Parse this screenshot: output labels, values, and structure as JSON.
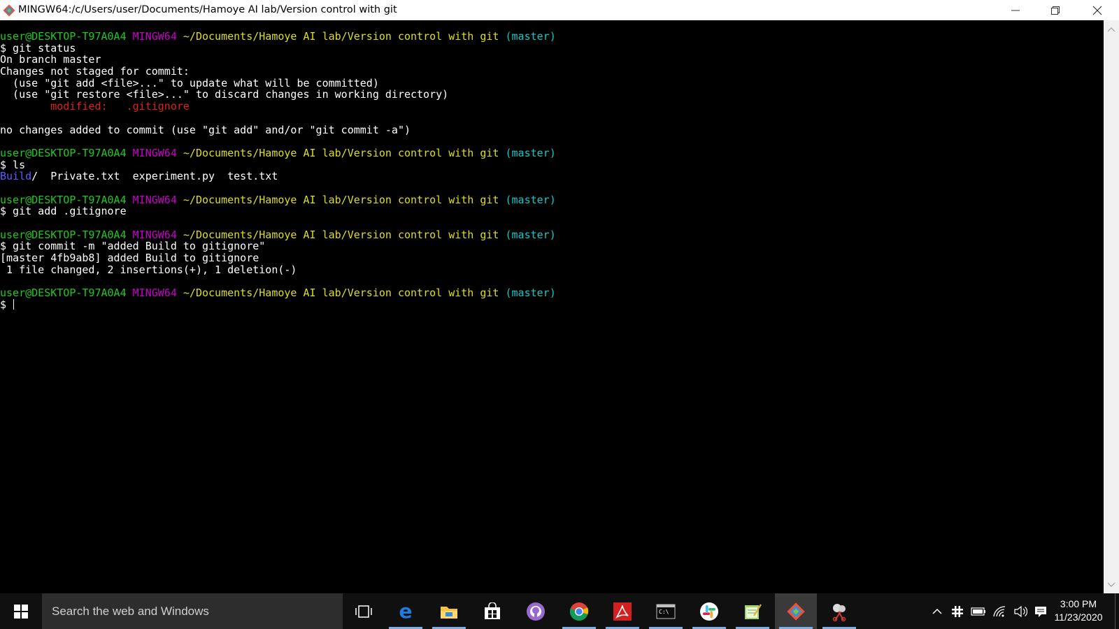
{
  "window": {
    "title": "MINGW64:/c/Users/user/Documents/Hamoye AI lab/Version control with git"
  },
  "terminal": {
    "lines": [
      [
        {
          "t": "user@DESKTOP-T97A0A4",
          "c": "g"
        },
        {
          "t": " ",
          "c": ""
        },
        {
          "t": "MINGW64",
          "c": "m"
        },
        {
          "t": " ",
          "c": ""
        },
        {
          "t": "~/Documents/Hamoye AI lab/Version control with git",
          "c": "y"
        },
        {
          "t": " ",
          "c": ""
        },
        {
          "t": "(master)",
          "c": "c"
        }
      ],
      [
        {
          "t": "$ git status",
          "c": ""
        }
      ],
      [
        {
          "t": "On branch master",
          "c": ""
        }
      ],
      [
        {
          "t": "Changes not staged for commit:",
          "c": ""
        }
      ],
      [
        {
          "t": "  (use \"git add <file>...\" to update what will be committed)",
          "c": ""
        }
      ],
      [
        {
          "t": "  (use \"git restore <file>...\" to discard changes in working directory)",
          "c": ""
        }
      ],
      [
        {
          "t": "        ",
          "c": ""
        },
        {
          "t": "modified:   .gitignore",
          "c": "r"
        }
      ],
      [],
      [
        {
          "t": "no changes added to commit (use \"git add\" and/or \"git commit -a\")",
          "c": ""
        }
      ],
      [],
      [
        {
          "t": "user@DESKTOP-T97A0A4",
          "c": "g"
        },
        {
          "t": " ",
          "c": ""
        },
        {
          "t": "MINGW64",
          "c": "m"
        },
        {
          "t": " ",
          "c": ""
        },
        {
          "t": "~/Documents/Hamoye AI lab/Version control with git",
          "c": "y"
        },
        {
          "t": " ",
          "c": ""
        },
        {
          "t": "(master)",
          "c": "c"
        }
      ],
      [
        {
          "t": "$ ls",
          "c": ""
        }
      ],
      [
        {
          "t": "Build",
          "c": "b"
        },
        {
          "t": "/  Private.txt  experiment.py  test.txt",
          "c": ""
        }
      ],
      [],
      [
        {
          "t": "user@DESKTOP-T97A0A4",
          "c": "g"
        },
        {
          "t": " ",
          "c": ""
        },
        {
          "t": "MINGW64",
          "c": "m"
        },
        {
          "t": " ",
          "c": ""
        },
        {
          "t": "~/Documents/Hamoye AI lab/Version control with git",
          "c": "y"
        },
        {
          "t": " ",
          "c": ""
        },
        {
          "t": "(master)",
          "c": "c"
        }
      ],
      [
        {
          "t": "$ git add .gitignore",
          "c": ""
        }
      ],
      [],
      [
        {
          "t": "user@DESKTOP-T97A0A4",
          "c": "g"
        },
        {
          "t": " ",
          "c": ""
        },
        {
          "t": "MINGW64",
          "c": "m"
        },
        {
          "t": " ",
          "c": ""
        },
        {
          "t": "~/Documents/Hamoye AI lab/Version control with git",
          "c": "y"
        },
        {
          "t": " ",
          "c": ""
        },
        {
          "t": "(master)",
          "c": "c"
        }
      ],
      [
        {
          "t": "$ git commit -m \"added Build to gitignore\"",
          "c": ""
        }
      ],
      [
        {
          "t": "[master 4fb9ab8] added Build to gitignore",
          "c": ""
        }
      ],
      [
        {
          "t": " 1 file changed, 2 insertions(+), 1 deletion(-)",
          "c": ""
        }
      ],
      [],
      [
        {
          "t": "user@DESKTOP-T97A0A4",
          "c": "g"
        },
        {
          "t": " ",
          "c": ""
        },
        {
          "t": "MINGW64",
          "c": "m"
        },
        {
          "t": " ",
          "c": ""
        },
        {
          "t": "~/Documents/Hamoye AI lab/Version control with git",
          "c": "y"
        },
        {
          "t": " ",
          "c": ""
        },
        {
          "t": "(master)",
          "c": "c"
        }
      ],
      [
        {
          "t": "$ ",
          "c": ""
        },
        {
          "cursor": true
        }
      ]
    ]
  },
  "taskbar": {
    "search_placeholder": "Search the web and Windows",
    "clock_time": "3:00 PM",
    "clock_date": "11/23/2020",
    "items": [
      {
        "name": "task-view-icon"
      },
      {
        "name": "edge-icon"
      },
      {
        "name": "file-explorer-icon"
      },
      {
        "name": "store-icon"
      },
      {
        "name": "github-desktop-icon"
      },
      {
        "name": "chrome-icon"
      },
      {
        "name": "acrobat-icon"
      },
      {
        "name": "cmd-icon"
      },
      {
        "name": "slack-icon"
      },
      {
        "name": "notepad-icon"
      },
      {
        "name": "git-bash-icon"
      },
      {
        "name": "snipping-tool-icon"
      }
    ]
  },
  "colors": {
    "prompt_user": "#1ec91e",
    "prompt_system": "#c900c9",
    "prompt_path": "#dede1e",
    "prompt_branch": "#15c7c7",
    "modified": "#e01f1f",
    "directory": "#5c5cff"
  }
}
